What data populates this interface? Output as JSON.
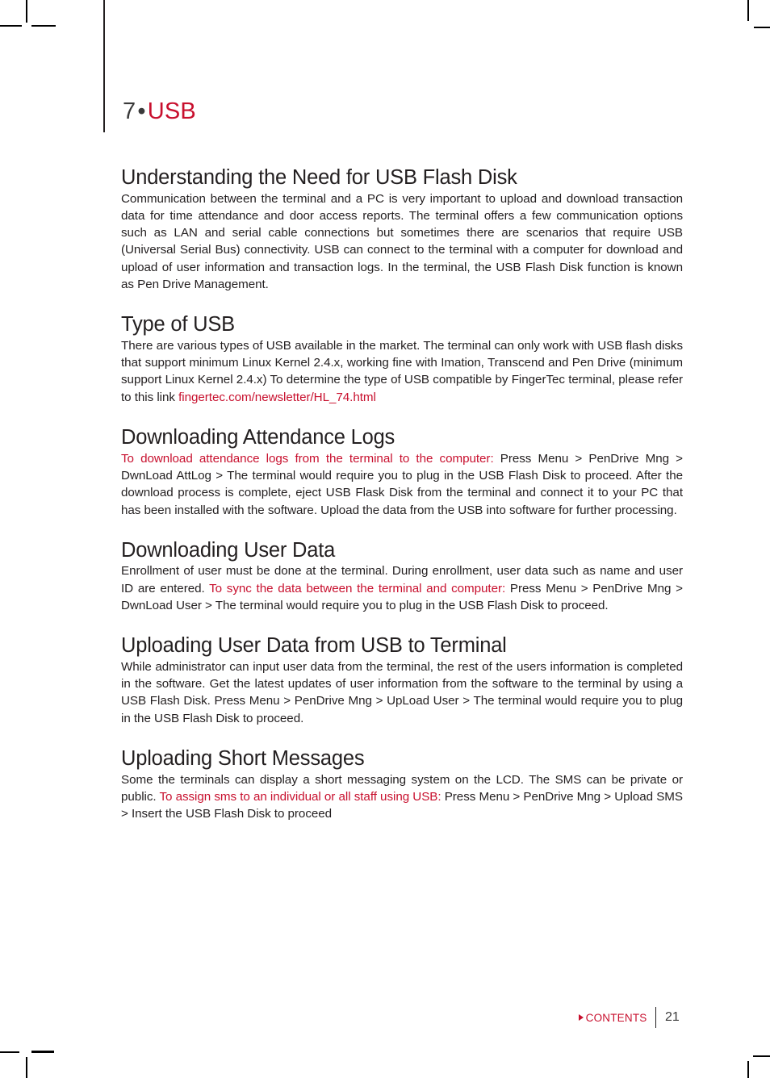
{
  "chapter": {
    "number": "7",
    "separator": "•",
    "title": "USB"
  },
  "sections": [
    {
      "heading": "Understanding the Need for USB Flash Disk",
      "body_text": "Communication between the terminal and a PC is very important to upload and download transaction data for time attendance and door access reports. The terminal offers a few communication options such as LAN and serial cable connections but sometimes there are scenarios that require USB (Universal Serial Bus) connectivity. USB can connect to the terminal with a computer for download and upload of user information and transaction logs. In the terminal, the USB Flash Disk function is known as Pen Drive Management."
    },
    {
      "heading": "Type of USB",
      "body_before": "There are various types of USB available in the market. The terminal can only work with USB flash disks that support minimum Linux Kernel 2.4.x, working fine with Imation, Transcend and Pen Drive (minimum support Linux Kernel 2.4.x) To determine the type of USB compatible by FingerTec terminal, please refer to this link ",
      "link_text": "fingertec.com/newsletter/HL_74.html",
      "body_after": ""
    },
    {
      "heading": "Downloading Attendance Logs",
      "highlight_text": "To download attendance logs from the terminal to the computer:",
      "body_after": " Press Menu > PenDrive Mng > DwnLoad AttLog > The terminal would require you to plug in the USB Flash Disk to proceed. After the download process is complete, eject USB Flask Disk from the terminal and connect it to your PC that has been installed with the software. Upload the data from the USB into software for further processing."
    },
    {
      "heading": "Downloading User Data",
      "body_before": "Enrollment of user must be done at the terminal. During enrollment, user data such as name and user ID are entered. ",
      "highlight_text": "To sync the data between the terminal and computer:",
      "body_after": " Press Menu > PenDrive Mng > DwnLoad User > The terminal would require you to plug in the USB Flash Disk to proceed."
    },
    {
      "heading": "Uploading User Data from USB to Terminal",
      "body_text": "While administrator can input user data from the terminal, the rest of the users information is completed in the software. Get the latest updates of user information from the software to the terminal by using a USB Flash Disk. Press Menu > PenDrive Mng > UpLoad User > The terminal would require you to plug in the USB Flash Disk to proceed."
    },
    {
      "heading": "Uploading Short Messages",
      "body_before": "Some the terminals can display a short messaging system on the LCD. The SMS can be private or public. ",
      "highlight_text": "To assign sms to an individual or all staff using USB:",
      "body_after": " Press Menu > PenDrive Mng > Upload SMS > Insert the USB Flash Disk to proceed"
    }
  ],
  "footer": {
    "contents_label": "CONTENTS",
    "page_number": "21"
  },
  "colors": {
    "accent_red": "#c8102e",
    "body_text": "#231f20",
    "page_number": "#3a3a3a"
  }
}
